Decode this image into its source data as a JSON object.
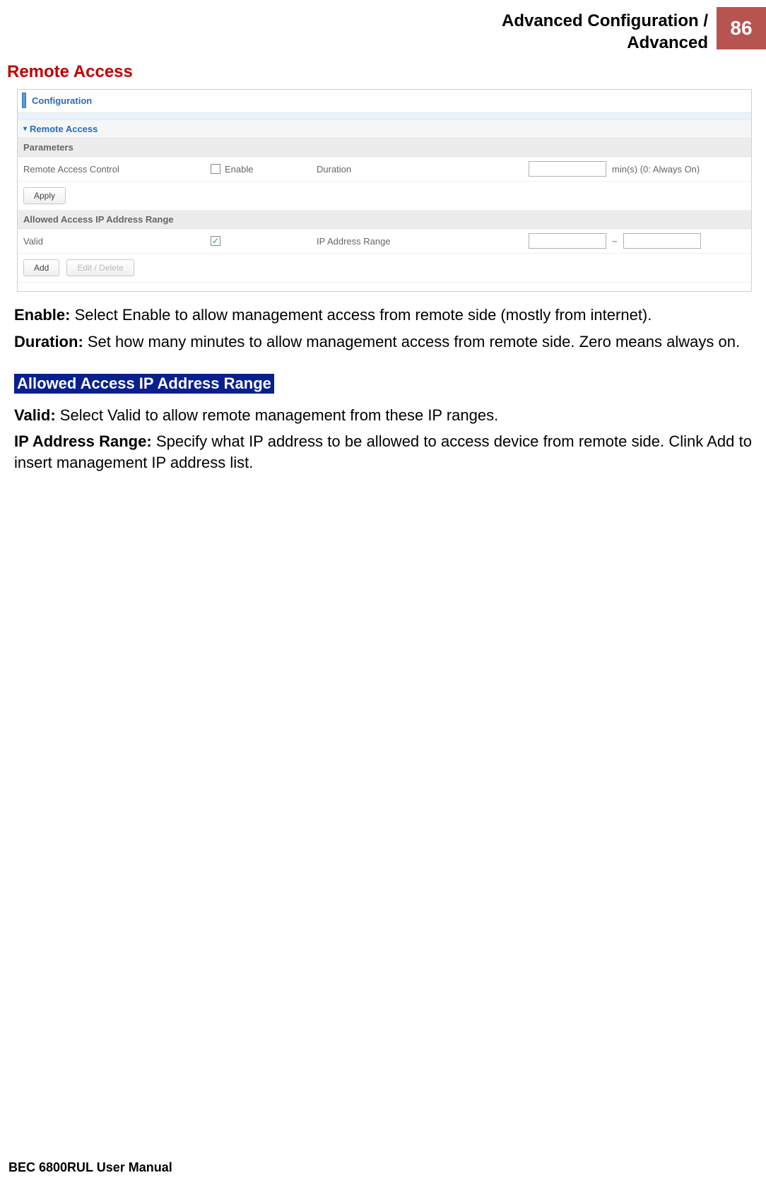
{
  "header": {
    "line1": "Advanced Configuration /",
    "line2": "Advanced",
    "page_number": "86"
  },
  "section_title": "Remote Access",
  "screenshot": {
    "configuration_label": "Configuration",
    "remote_access_header": "Remote Access",
    "parameters_label": "Parameters",
    "remote_access_control_label": "Remote Access Control",
    "enable_checkbox_label": "Enable",
    "duration_label": "Duration",
    "duration_unit": "min(s)   (0: Always On)",
    "apply_button": "Apply",
    "allowed_range_header": "Allowed Access IP Address Range",
    "valid_label": "Valid",
    "ip_range_label": "IP Address Range",
    "ip_separator": "~",
    "add_button": "Add",
    "edit_delete_button": "Edit / Delete"
  },
  "descriptions": {
    "enable_label": "Enable:",
    "enable_text": " Select Enable to allow management access from remote side (mostly from internet).",
    "duration_label": "Duration:",
    "duration_text": " Set how many minutes to allow management access from remote side. Zero means always on.",
    "allowed_heading": "Allowed Access IP Address Range",
    "valid_label": "Valid:",
    "valid_text": " Select Valid to allow remote management from these IP ranges.",
    "iprange_label": "IP Address Range:",
    "iprange_text": " Specify what IP address to be allowed to access device from remote side. Clink Add to insert management IP address list."
  },
  "footer": "BEC 6800RUL User Manual"
}
